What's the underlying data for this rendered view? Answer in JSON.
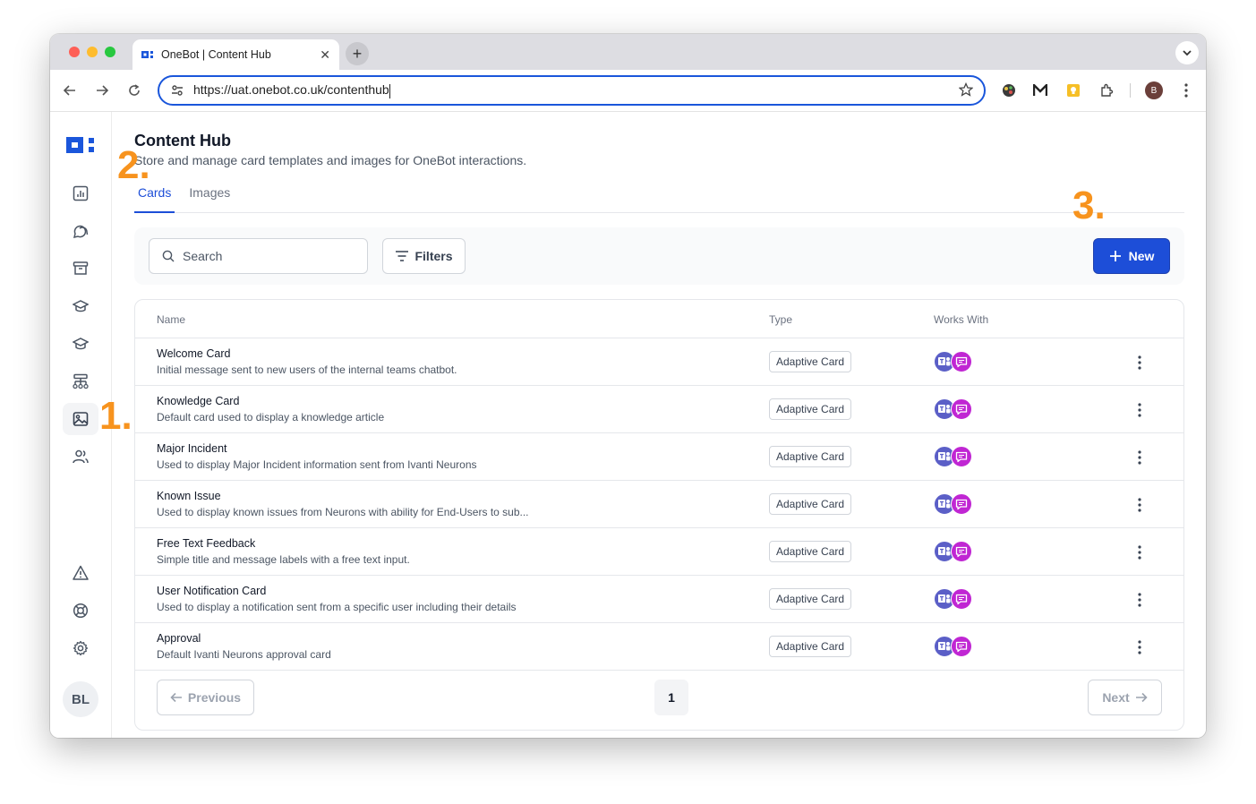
{
  "browser": {
    "tab_title": "OneBot | Content Hub",
    "tab_close": "✕",
    "new_tab": "+",
    "url": "https://uat.onebot.co.uk/contenthub",
    "profile_initial": "B"
  },
  "sidebar": {
    "items": [
      {
        "icon": "chart-icon"
      },
      {
        "icon": "chat-bubbles-icon"
      },
      {
        "icon": "archive-icon"
      },
      {
        "icon": "graduation-cap-icon"
      },
      {
        "icon": "graduation-cap-icon"
      },
      {
        "icon": "workflow-icon"
      },
      {
        "icon": "image-icon",
        "active": true
      },
      {
        "icon": "users-icon"
      },
      {
        "icon": "warning-icon"
      },
      {
        "icon": "lifebuoy-icon"
      },
      {
        "icon": "gear-icon"
      }
    ],
    "user_initials": "BL"
  },
  "page": {
    "title": "Content Hub",
    "subtitle": "Store and manage card templates and images for OneBot interactions."
  },
  "tabs": [
    {
      "label": "Cards",
      "active": true
    },
    {
      "label": "Images",
      "active": false
    }
  ],
  "toolbar": {
    "search_placeholder": "Search",
    "filters_label": "Filters",
    "new_label": "New"
  },
  "table": {
    "columns": [
      "Name",
      "Type",
      "Works With"
    ],
    "rows": [
      {
        "name": "Welcome Card",
        "description": "Initial message sent to new users of the internal teams chatbot.",
        "type": "Adaptive Card"
      },
      {
        "name": "Knowledge Card",
        "description": "Default card used to display a knowledge article",
        "type": "Adaptive Card"
      },
      {
        "name": "Major Incident",
        "description": "Used to display Major Incident information sent from Ivanti Neurons",
        "type": "Adaptive Card"
      },
      {
        "name": "Known Issue",
        "description": "Used to display known issues from Neurons with ability for End-Users to sub...",
        "type": "Adaptive Card"
      },
      {
        "name": "Free Text Feedback",
        "description": "Simple title and message labels with a free text input.",
        "type": "Adaptive Card"
      },
      {
        "name": "User Notification Card",
        "description": "Used to display a notification sent from a specific user including their details",
        "type": "Adaptive Card"
      },
      {
        "name": "Approval",
        "description": "Default Ivanti Neurons approval card",
        "type": "Adaptive Card"
      }
    ]
  },
  "pagination": {
    "previous_label": "Previous",
    "current_page": "1",
    "next_label": "Next"
  },
  "annotations": [
    "1.",
    "2.",
    "3."
  ],
  "colors": {
    "accent": "#1d4ed8",
    "annotation": "#f7931e",
    "teams": "#5b5fc7",
    "chat": "#c026d3"
  }
}
